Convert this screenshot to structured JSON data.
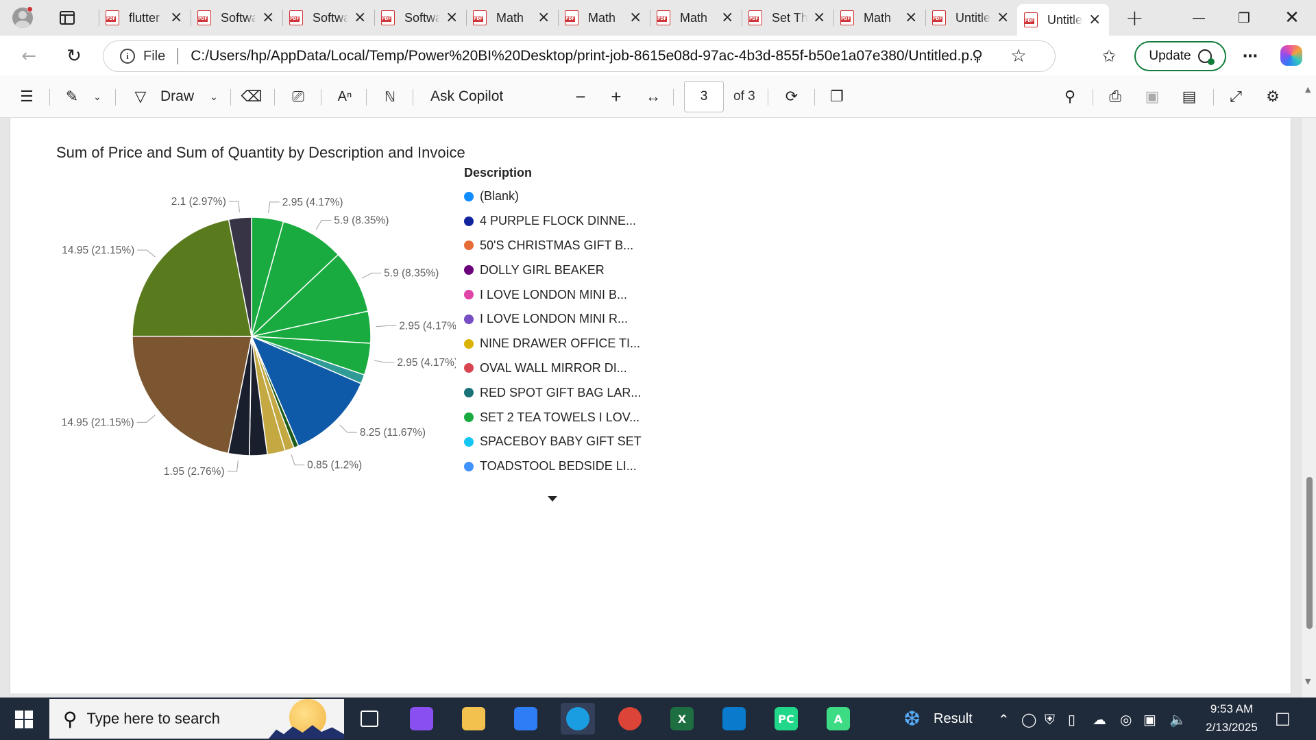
{
  "browser": {
    "tabs": [
      {
        "title": "flutter",
        "active": false
      },
      {
        "title": "Software",
        "active": false
      },
      {
        "title": "Software",
        "active": false
      },
      {
        "title": "Software",
        "active": false
      },
      {
        "title": "Math",
        "active": false
      },
      {
        "title": "Math",
        "active": false
      },
      {
        "title": "Math",
        "active": false
      },
      {
        "title": "Set Th",
        "active": false
      },
      {
        "title": "Math",
        "active": false
      },
      {
        "title": "Untitled",
        "active": false
      },
      {
        "title": "Untitled",
        "active": true
      }
    ],
    "pdf_badge": "PDF",
    "scheme_label": "File",
    "url": "C:/Users/hp/AppData/Local/Temp/Power%20BI%20Desktop/print-job-8615e08d-97ac-4b3d-855f-b50e1a07e380/Untitled.p...",
    "update_label": "Update",
    "icons": [
      "profile-icon",
      "tab-actions-icon",
      "new-tab-icon",
      "minimize-icon",
      "restore-icon",
      "close-icon",
      "back-icon",
      "refresh-icon",
      "info-icon",
      "zoom-icon",
      "favorite-icon",
      "favorites-icon",
      "more-icon",
      "copilot-icon"
    ]
  },
  "pdf_toolbar": {
    "draw_label": "Draw",
    "ask_copilot_label": "Ask Copilot",
    "current_page": "3",
    "page_count_label": "of 3"
  },
  "chart_data": {
    "type": "pie",
    "title": "Sum of Price and Sum of Quantity by Description and Invoice",
    "slices": [
      {
        "value": 2.95,
        "label": "2.95 (4.17%)",
        "color": "#1aab40"
      },
      {
        "value": 5.9,
        "label": "5.9 (8.35%)",
        "color": "#1aab40"
      },
      {
        "value": 5.9,
        "label": "5.9 (8.35%)",
        "color": "#1aab40"
      },
      {
        "value": 2.95,
        "label": "2.95 (4.17%)",
        "color": "#1aab40"
      },
      {
        "value": 2.95,
        "label": "2.95 (4.17%)",
        "color": "#1aab40"
      },
      {
        "value": 0.85,
        "label": "",
        "color": "#2f9a96"
      },
      {
        "value": 8.25,
        "label": "8.25 (11.67%)",
        "color": "#0f5aa8"
      },
      {
        "value": 0.45,
        "label": "",
        "color": "#1f5c1a"
      },
      {
        "value": 0.85,
        "label": "0.85 (1.2%)",
        "color": "#c4a842"
      },
      {
        "value": 1.65,
        "label": "",
        "color": "#c4a842"
      },
      {
        "value": 1.65,
        "label": "",
        "color": "#1a1f2e"
      },
      {
        "value": 1.95,
        "label": "1.95 (2.76%)",
        "color": "#1a1f2e"
      },
      {
        "value": 14.95,
        "label": "14.95 (21.15%)",
        "color": "#7b5630"
      },
      {
        "value": 14.95,
        "label": "14.95 (21.15%)",
        "color": "#5a7a1e"
      },
      {
        "value": 2.1,
        "label": "2.1 (2.97%)",
        "color": "#373445"
      }
    ],
    "legend": {
      "title": "Description",
      "position": "right",
      "items": [
        {
          "label": "(Blank)",
          "color": "#118dff"
        },
        {
          "label": "4 PURPLE FLOCK DINNE...",
          "color": "#12239e"
        },
        {
          "label": "50'S CHRISTMAS GIFT B...",
          "color": "#e66c37"
        },
        {
          "label": "DOLLY GIRL BEAKER",
          "color": "#6b007b"
        },
        {
          "label": "I LOVE LONDON MINI B...",
          "color": "#e044a7"
        },
        {
          "label": "I LOVE LONDON MINI R...",
          "color": "#744ec2"
        },
        {
          "label": "NINE DRAWER OFFICE TI...",
          "color": "#d9b300"
        },
        {
          "label": "OVAL WALL MIRROR DI...",
          "color": "#d64550"
        },
        {
          "label": "RED SPOT GIFT BAG LAR...",
          "color": "#197278"
        },
        {
          "label": "SET 2 TEA TOWELS I LOV...",
          "color": "#1aab40"
        },
        {
          "label": "SPACEBOY BABY GIFT SET",
          "color": "#15c6f4"
        },
        {
          "label": "TOADSTOOL BEDSIDE LI...",
          "color": "#4092ff"
        }
      ]
    }
  },
  "taskbar": {
    "search_placeholder": "Type here to search",
    "result_label": "Result",
    "time": "9:53 AM",
    "date": "2/13/2025",
    "apps": [
      {
        "name": "task-view-icon",
        "color": "#1f2a3a",
        "glyph": ""
      },
      {
        "name": "copilot-app-icon",
        "color": "#8a4ff0",
        "glyph": ""
      },
      {
        "name": "file-explorer-icon",
        "color": "#f2c14e",
        "glyph": ""
      },
      {
        "name": "microsoft-store-icon",
        "color": "#2f7df6",
        "glyph": ""
      },
      {
        "name": "edge-icon",
        "color": "#1b9de2",
        "glyph": ""
      },
      {
        "name": "chrome-icon",
        "color": "#db4437",
        "glyph": ""
      },
      {
        "name": "excel-icon",
        "color": "#1d6f42",
        "glyph": "X"
      },
      {
        "name": "vscode-icon",
        "color": "#0a7acc",
        "glyph": ""
      },
      {
        "name": "pycharm-icon",
        "color": "#21d789",
        "glyph": "PC"
      },
      {
        "name": "android-studio-icon",
        "color": "#3ddc84",
        "glyph": "A"
      }
    ]
  }
}
